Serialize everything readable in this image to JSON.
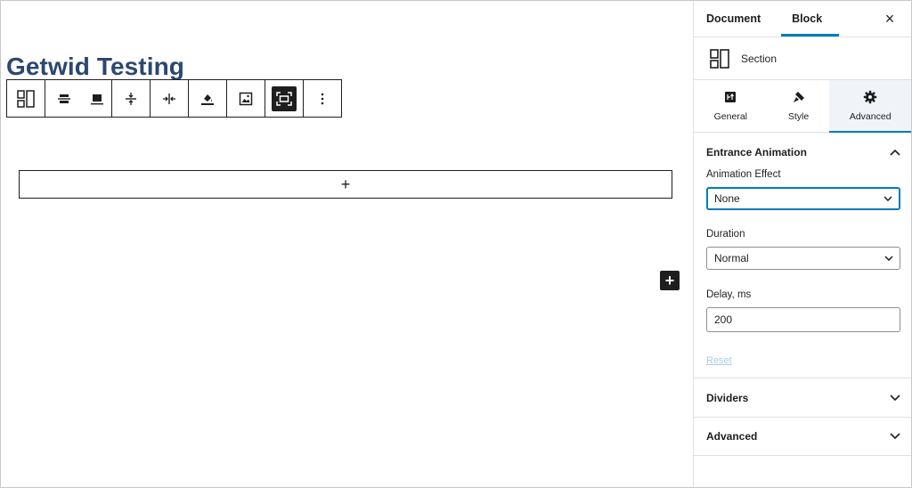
{
  "editor": {
    "post_title": "Getwid Testing",
    "toolbar": {
      "buttons": [
        {
          "icon": "section-block-icon"
        },
        {
          "icon": "vertical-align-middle-icon"
        },
        {
          "icon": "vertical-align-bottom-icon"
        },
        {
          "icon": "vertical-spacing-icon"
        },
        {
          "icon": "horizontal-spacing-icon"
        },
        {
          "icon": "background-color-icon"
        },
        {
          "icon": "background-image-icon"
        },
        {
          "icon": "full-width-icon",
          "active": true
        },
        {
          "icon": "more-options-icon"
        }
      ]
    },
    "appender_glyph": "+",
    "inserter_glyph": "+"
  },
  "sidebar": {
    "tabs": [
      {
        "label": "Document",
        "active": false
      },
      {
        "label": "Block",
        "active": true
      }
    ],
    "close_glyph": "×",
    "block": {
      "name": "Section",
      "icon": "section-block-icon"
    },
    "panel_tabs": [
      {
        "label": "General",
        "icon": "general-icon",
        "active": false
      },
      {
        "label": "Style",
        "icon": "brush-icon",
        "active": false
      },
      {
        "label": "Advanced",
        "icon": "gear-icon",
        "active": true
      }
    ],
    "entrance_animation": {
      "title": "Entrance Animation",
      "expanded": true,
      "animation_effect": {
        "label": "Animation Effect",
        "value": "None"
      },
      "duration": {
        "label": "Duration",
        "value": "Normal"
      },
      "delay": {
        "label": "Delay, ms",
        "value": "200"
      },
      "reset_label": "Reset"
    },
    "collapsed_sections": [
      {
        "title": "Dividers"
      },
      {
        "title": "Advanced"
      }
    ],
    "accent_color": "#007cba"
  }
}
